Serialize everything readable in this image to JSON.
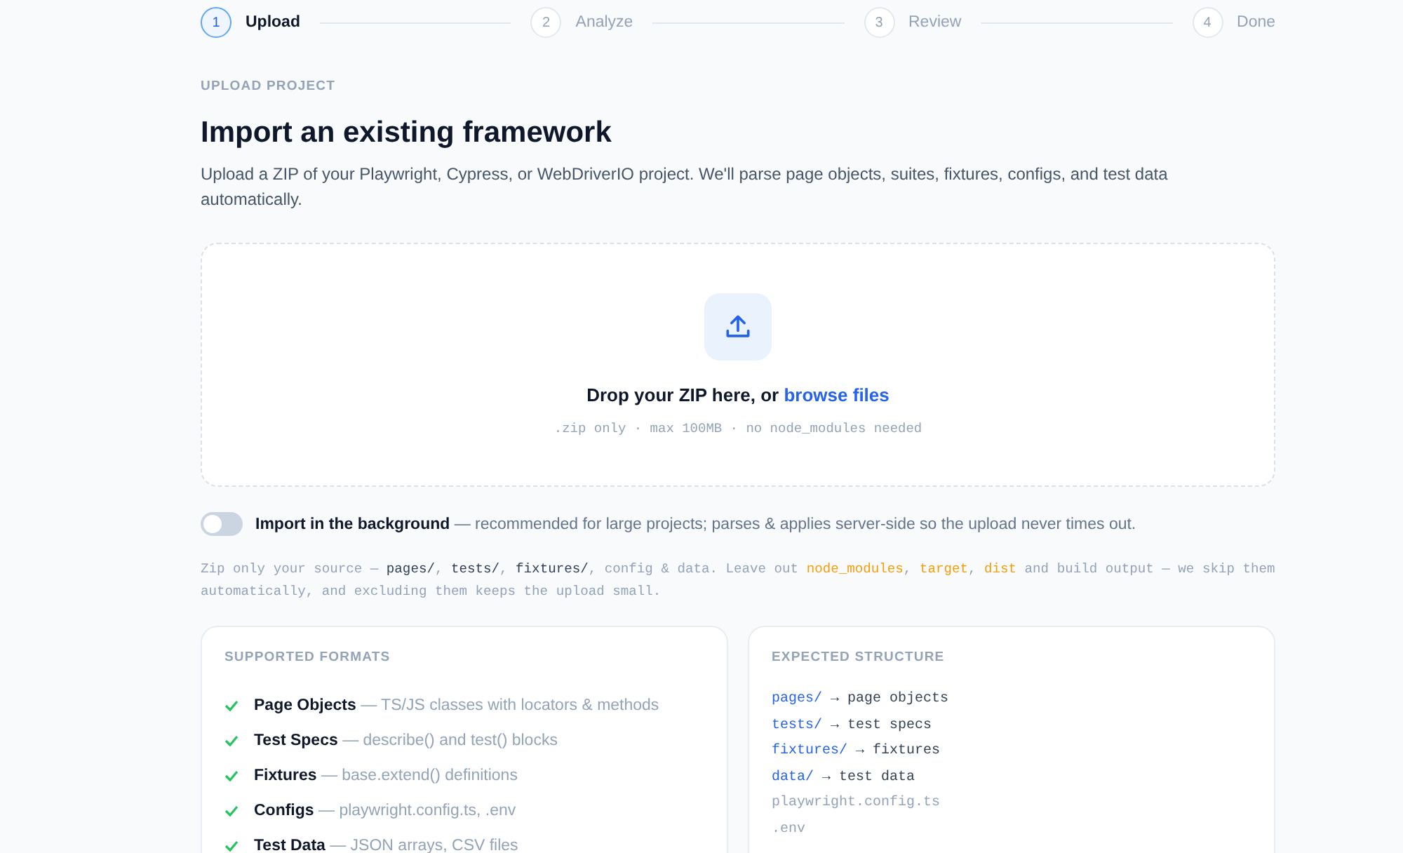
{
  "steps": [
    {
      "number": "1",
      "label": "Upload",
      "selected": true
    },
    {
      "number": "2",
      "label": "Analyze",
      "selected": false
    },
    {
      "number": "3",
      "label": "Review",
      "selected": false
    },
    {
      "number": "4",
      "label": "Done",
      "selected": false
    }
  ],
  "eyebrow": "UPLOAD PROJECT",
  "title": "Import an existing framework",
  "description": "Upload a ZIP of your Playwright, Cypress, or WebDriverIO project. We'll parse page objects, suites, fixtures, configs, and test data automatically.",
  "dropzone": {
    "prompt": "Drop your ZIP here, or ",
    "link": "browse files",
    "hint": ".zip only · max 100MB · no node_modules needed"
  },
  "background_toggle": {
    "on": false,
    "label": "Import in the background",
    "detail": " — recommended for large projects; parses & applies server-side so the upload never times out."
  },
  "source_hint": [
    {
      "kind": "plain",
      "text": "Zip only your source — "
    },
    {
      "kind": "path",
      "text": "pages/"
    },
    {
      "kind": "plain",
      "text": ", "
    },
    {
      "kind": "path",
      "text": "tests/"
    },
    {
      "kind": "plain",
      "text": ", "
    },
    {
      "kind": "path",
      "text": "fixtures/"
    },
    {
      "kind": "plain",
      "text": ", config & data. Leave out "
    },
    {
      "kind": "excluded",
      "text": "node_modules"
    },
    {
      "kind": "plain",
      "text": ", "
    },
    {
      "kind": "excluded",
      "text": "target"
    },
    {
      "kind": "plain",
      "text": ", "
    },
    {
      "kind": "excluded",
      "text": "dist"
    },
    {
      "kind": "plain",
      "text": " and build output — we skip them automatically, and excluding them keeps the upload small."
    }
  ],
  "supported_formats": {
    "title": "SUPPORTED FORMATS",
    "items": [
      {
        "name": "Page Objects",
        "detail": " — TS/JS classes with locators & methods"
      },
      {
        "name": "Test Specs",
        "detail": " — describe() and test() blocks"
      },
      {
        "name": "Fixtures",
        "detail": " — base.extend() definitions"
      },
      {
        "name": "Configs",
        "detail": " — playwright.config.ts, .env"
      },
      {
        "name": "Test Data",
        "detail": " — JSON arrays, CSV files"
      }
    ]
  },
  "expected_structure": {
    "title": "EXPECTED STRUCTURE",
    "lines": [
      {
        "kind": "dir",
        "path": "pages/",
        "meaning": " → page objects"
      },
      {
        "kind": "dir",
        "path": "tests/",
        "meaning": " → test specs"
      },
      {
        "kind": "dir",
        "path": "fixtures/",
        "meaning": " → fixtures"
      },
      {
        "kind": "dir",
        "path": "data/",
        "meaning": " → test data"
      },
      {
        "kind": "file",
        "path": "playwright.config.ts"
      },
      {
        "kind": "file",
        "path": ".env"
      }
    ]
  }
}
